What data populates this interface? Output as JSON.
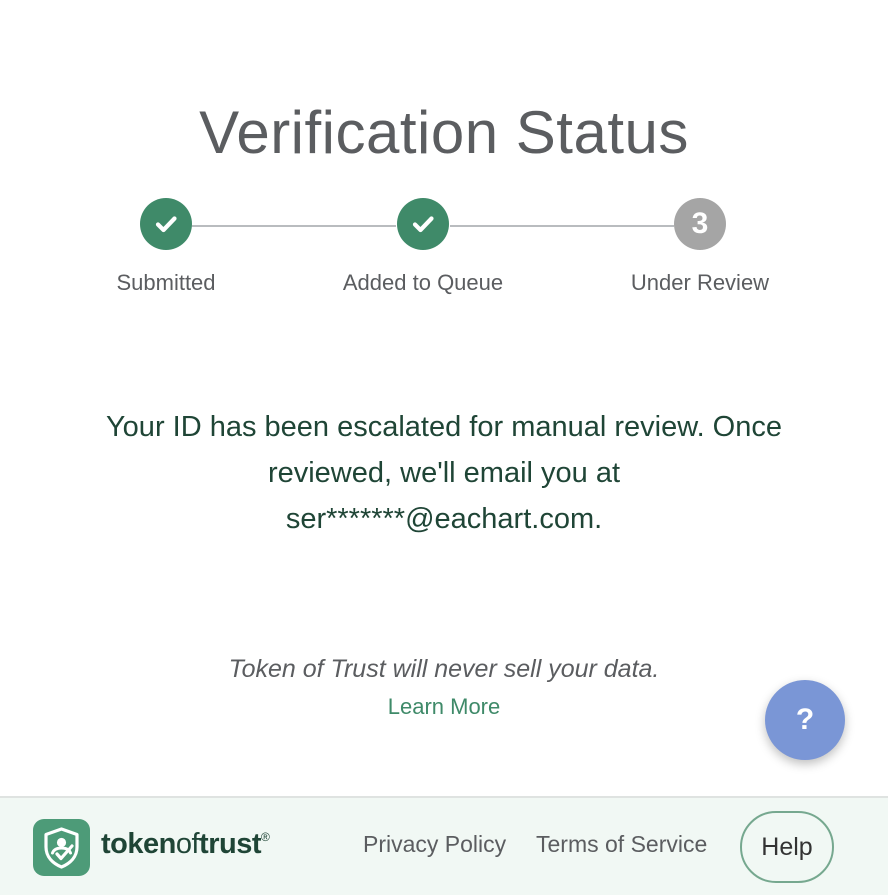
{
  "page": {
    "title": "Verification Status"
  },
  "steps": [
    {
      "label": "Submitted",
      "status": "complete"
    },
    {
      "label": "Added to Queue",
      "status": "complete"
    },
    {
      "label": "Under Review",
      "status": "current",
      "number": "3"
    }
  ],
  "message": {
    "line1": "Your ID has been escalated for manual review. Once",
    "line2": "reviewed, we'll email you at",
    "line3": "ser*******@eachart.com."
  },
  "privacy": {
    "note": "Token of Trust will never sell your data.",
    "learn_more": "Learn More"
  },
  "fab": {
    "label": "?"
  },
  "footer": {
    "brand_token": "token",
    "brand_of": "of",
    "brand_trust": "trust",
    "brand_reg": "®",
    "privacy_policy": "Privacy Policy",
    "terms": "Terms of Service",
    "help": "Help"
  },
  "colors": {
    "accent_green": "#3f8a69",
    "dark_green": "#1f4536",
    "pending_gray": "#a5a5a5",
    "fab_blue": "#7a96d6",
    "footer_bg": "#f1f8f4"
  }
}
